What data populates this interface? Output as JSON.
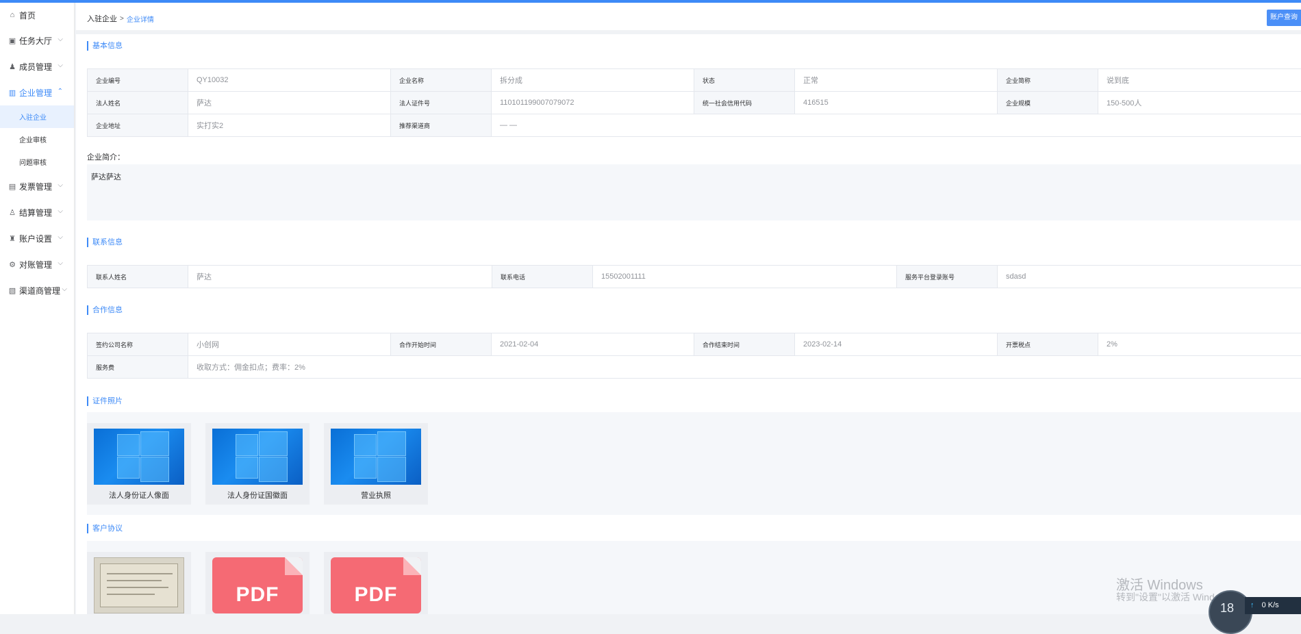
{
  "sidebar": {
    "items": [
      {
        "label": "首页",
        "icon": "home-icon",
        "glyph": "⌂",
        "has_children": false
      },
      {
        "label": "任务大厅",
        "icon": "task-icon",
        "glyph": "▣",
        "has_children": true
      },
      {
        "label": "成员管理",
        "icon": "members-icon",
        "glyph": "♟",
        "has_children": true
      },
      {
        "label": "企业管理",
        "icon": "enterprise-icon",
        "glyph": "▥",
        "has_children": true,
        "expanded": true
      },
      {
        "label": "发票管理",
        "icon": "invoice-icon",
        "glyph": "▤",
        "has_children": true
      },
      {
        "label": "结算管理",
        "icon": "settlement-icon",
        "glyph": "♙",
        "has_children": true
      },
      {
        "label": "账户设置",
        "icon": "account-icon",
        "glyph": "♜",
        "has_children": true
      },
      {
        "label": "对账管理",
        "icon": "reconcile-icon",
        "glyph": "⚙",
        "has_children": true
      },
      {
        "label": "渠道商管理",
        "icon": "channel-icon",
        "glyph": "▧",
        "has_children": true
      }
    ],
    "sub_items": [
      {
        "label": "入驻企业",
        "active": true
      },
      {
        "label": "企业审核",
        "active": false
      },
      {
        "label": "问题审核",
        "active": false
      }
    ]
  },
  "breadcrumb": {
    "parent": "入驻企业",
    "separator": ">",
    "current": "企业详情"
  },
  "header": {
    "account_button": "账户查询"
  },
  "basic_info": {
    "title": "基本信息",
    "rows": [
      [
        {
          "label": "企业编号",
          "value": "QY10032"
        },
        {
          "label": "企业名称",
          "value": "拆分成"
        },
        {
          "label": "状态",
          "value": "正常"
        },
        {
          "label": "企业简称",
          "value": "说到底"
        }
      ],
      [
        {
          "label": "法人姓名",
          "value": "萨达"
        },
        {
          "label": "法人证件号",
          "value": "110101199007079072"
        },
        {
          "label": "统一社会信用代码",
          "value": "416515"
        },
        {
          "label": "企业规模",
          "value": "150-500人"
        }
      ],
      [
        {
          "label": "企业地址",
          "value": "实打实2"
        },
        {
          "label": "推荐渠道商",
          "value": "— —"
        }
      ]
    ],
    "intro_label": "企业简介：",
    "intro_text": "萨达萨达"
  },
  "contact_info": {
    "title": "联系信息",
    "rows": [
      [
        {
          "label": "联系人姓名",
          "value": "萨达"
        },
        {
          "label": "联系电话",
          "value": "15502001111"
        },
        {
          "label": "服务平台登录账号",
          "value": "sdasd"
        }
      ]
    ]
  },
  "cooperation_info": {
    "title": "合作信息",
    "rows": [
      [
        {
          "label": "签约公司名称",
          "value": "小创网"
        },
        {
          "label": "合作开始时间",
          "value": "2021-02-04"
        },
        {
          "label": "合作结束时间",
          "value": "2023-02-14"
        },
        {
          "label": "开票税点",
          "value": "2%"
        }
      ],
      [
        {
          "label": "服务费",
          "value": "收取方式：佣金扣点；费率：2%"
        }
      ]
    ]
  },
  "certificates": {
    "title": "证件照片",
    "items": [
      {
        "caption": "法人身份证人像面",
        "type": "image"
      },
      {
        "caption": "法人身份证国徽面",
        "type": "image"
      },
      {
        "caption": "营业执照",
        "type": "image"
      }
    ]
  },
  "agreements": {
    "title": "客户协议",
    "items": [
      {
        "type": "certificate-image"
      },
      {
        "type": "pdf",
        "text": "PDF"
      },
      {
        "type": "pdf",
        "text": "PDF"
      }
    ]
  },
  "overlay": {
    "watermark_line1": "激活 Windows",
    "watermark_line2": "转到\"设置\"以激活 Windows。",
    "gauge_value": "18",
    "net_speed": "0",
    "net_unit": "K/s",
    "net_arrow": "↑"
  },
  "colors": {
    "accent": "#3d8af7",
    "label_bg": "#f5f7fa",
    "border": "#e4e7ed",
    "pdf_red": "#f56a74"
  }
}
